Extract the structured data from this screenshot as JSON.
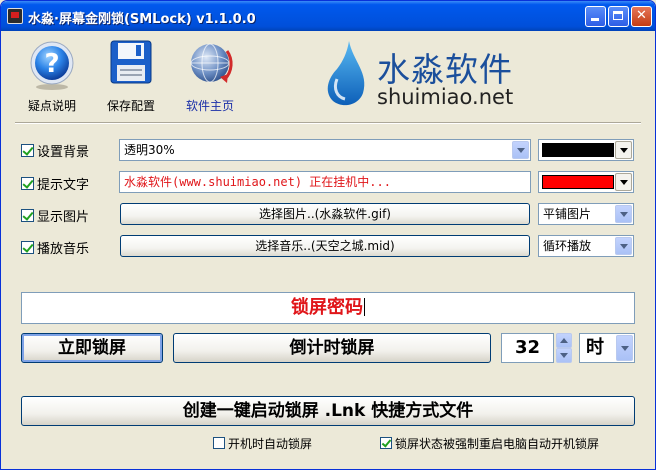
{
  "window": {
    "title": "水淼·屏幕金刚锁(SMLock) v1.1.0.0"
  },
  "toolbar": {
    "help_label": "疑点说明",
    "save_label": "保存配置",
    "home_label": "软件主页"
  },
  "logo": {
    "cn": "水淼软件",
    "en": "shuimiao.net"
  },
  "background": {
    "label": "设置背景",
    "checked": true,
    "value": "透明30%",
    "color": "#000000"
  },
  "prompt_text": {
    "label": "提示文字",
    "checked": true,
    "value": "水淼软件(www.shuimiao.net) 正在挂机中...",
    "text_color": "#e0161a",
    "color": "#ff0000"
  },
  "image": {
    "label": "显示图片",
    "checked": true,
    "button": "选择图片..(水淼软件.gif)",
    "mode": "平铺图片"
  },
  "music": {
    "label": "播放音乐",
    "checked": true,
    "button": "选择音乐..(天空之城.mid)",
    "mode": "循环播放"
  },
  "password": {
    "value": "锁屏密码"
  },
  "actions": {
    "lock_now": "立即锁屏",
    "countdown_lock": "倒计时锁屏",
    "countdown_value": "32",
    "countdown_unit": "时",
    "create_shortcut": "创建一键启动锁屏  .Lnk  快捷方式文件"
  },
  "options": {
    "autostart_label": "开机时自动锁屏",
    "autostart_checked": false,
    "force_restart_label": "锁屏状态被强制重启电脑自动开机锁屏",
    "force_restart_checked": true
  }
}
